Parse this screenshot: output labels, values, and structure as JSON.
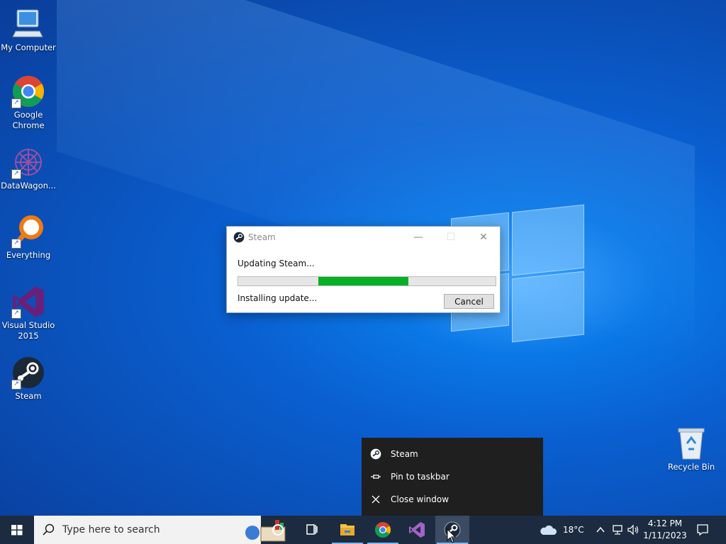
{
  "desktop": {
    "icons": [
      {
        "label": "My Computer"
      },
      {
        "label": "Google Chrome"
      },
      {
        "label": "DataWagon..."
      },
      {
        "label": "Everything"
      },
      {
        "label": "Visual Studio 2015"
      },
      {
        "label": "Steam"
      },
      {
        "label": "Recycle Bin"
      }
    ]
  },
  "dialog": {
    "title": "Steam",
    "message": "Updating Steam...",
    "status": "Installing update...",
    "cancel_label": "Cancel",
    "progress_start_fraction": 0.31,
    "progress_end_fraction": 0.66
  },
  "jumplist": {
    "items": [
      {
        "label": "Steam",
        "icon": "steam-icon"
      },
      {
        "label": "Pin to taskbar",
        "icon": "pin-icon"
      },
      {
        "label": "Close window",
        "icon": "close-icon"
      }
    ]
  },
  "taskbar": {
    "search_placeholder": "Type here to search",
    "weather_temp": "18°C",
    "time": "4:12 PM",
    "date": "1/11/2023"
  },
  "colors": {
    "progress_fill": "#06b025",
    "taskbar_bg": "#1c2b3f",
    "jumplist_bg": "#1f1f1f"
  }
}
